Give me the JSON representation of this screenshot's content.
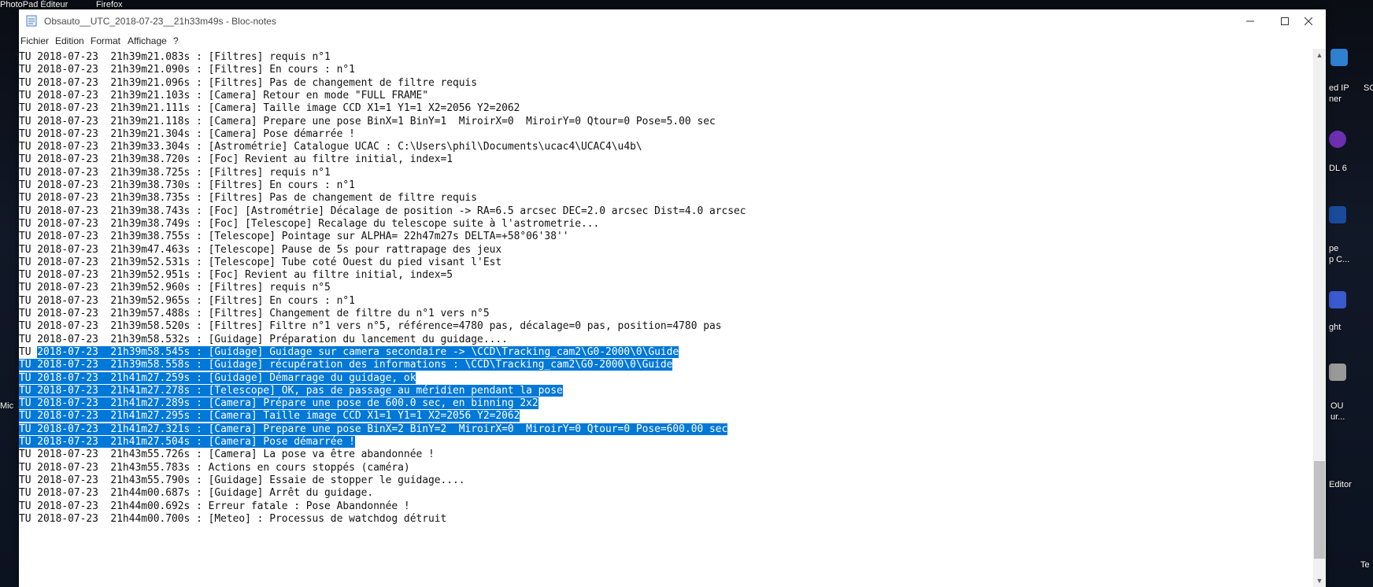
{
  "desktop": {
    "left_labels": [
      "PhotoPad Éditeur",
      "Firefox"
    ],
    "right_labels": [
      "ed IP",
      "ner",
      "DL 6",
      "pe",
      "p C...",
      "ght",
      "OU",
      "ur...",
      "Editor",
      "SC",
      "Te"
    ],
    "left_fragments": [
      "Mic"
    ]
  },
  "window": {
    "title": "Obsauto__UTC_2018-07-23__21h33m49s - Bloc-notes",
    "menu": [
      "Fichier",
      "Edition",
      "Format",
      "Affichage",
      "?"
    ]
  },
  "lines": [
    {
      "text": "TU 2018-07-23  21h39m21.083s : [Filtres] requis n°1",
      "selected": false
    },
    {
      "text": "TU 2018-07-23  21h39m21.090s : [Filtres] En cours : n°1",
      "selected": false
    },
    {
      "text": "TU 2018-07-23  21h39m21.096s : [Filtres] Pas de changement de filtre requis",
      "selected": false
    },
    {
      "text": "TU 2018-07-23  21h39m21.103s : [Camera] Retour en mode \"FULL FRAME\"",
      "selected": false
    },
    {
      "text": "TU 2018-07-23  21h39m21.111s : [Camera] Taille image CCD X1=1 Y1=1 X2=2056 Y2=2062",
      "selected": false
    },
    {
      "text": "TU 2018-07-23  21h39m21.118s : [Camera] Prepare une pose BinX=1 BinY=1  MiroirX=0  MiroirY=0 Qtour=0 Pose=5.00 sec",
      "selected": false
    },
    {
      "text": "TU 2018-07-23  21h39m21.304s : [Camera] Pose démarrée !",
      "selected": false
    },
    {
      "text": "TU 2018-07-23  21h39m33.304s : [Astrométrie] Catalogue UCAC : C:\\Users\\phil\\Documents\\ucac4\\UCAC4\\u4b\\",
      "selected": false
    },
    {
      "text": "TU 2018-07-23  21h39m38.720s : [Foc] Revient au filtre initial, index=1",
      "selected": false
    },
    {
      "text": "TU 2018-07-23  21h39m38.725s : [Filtres] requis n°1",
      "selected": false
    },
    {
      "text": "TU 2018-07-23  21h39m38.730s : [Filtres] En cours : n°1",
      "selected": false
    },
    {
      "text": "TU 2018-07-23  21h39m38.735s : [Filtres] Pas de changement de filtre requis",
      "selected": false
    },
    {
      "text": "TU 2018-07-23  21h39m38.743s : [Foc] [Astrométrie] Décalage de position -> RA=6.5 arcsec DEC=2.0 arcsec Dist=4.0 arcsec",
      "selected": false
    },
    {
      "text": "TU 2018-07-23  21h39m38.749s : [Foc] [Telescope] Recalage du telescope suite à l'astrometrie...",
      "selected": false
    },
    {
      "text": "TU 2018-07-23  21h39m38.755s : [Telescope] Pointage sur ALPHA= 22h47m27s DELTA=+58°06'38''",
      "selected": false
    },
    {
      "text": "TU 2018-07-23  21h39m47.463s : [Telescope] Pause de 5s pour rattrapage des jeux",
      "selected": false
    },
    {
      "text": "TU 2018-07-23  21h39m52.531s : [Telescope] Tube coté Ouest du pied visant l'Est",
      "selected": false
    },
    {
      "text": "TU 2018-07-23  21h39m52.951s : [Foc] Revient au filtre initial, index=5",
      "selected": false
    },
    {
      "text": "TU 2018-07-23  21h39m52.960s : [Filtres] requis n°5",
      "selected": false
    },
    {
      "text": "TU 2018-07-23  21h39m52.965s : [Filtres] En cours : n°1",
      "selected": false
    },
    {
      "text": "TU 2018-07-23  21h39m57.488s : [Filtres] Changement de filtre du n°1 vers n°5",
      "selected": false
    },
    {
      "text": "TU 2018-07-23  21h39m58.520s : [Filtres] Filtre n°1 vers n°5, référence=4780 pas, décalage=0 pas, position=4780 pas",
      "selected": false
    },
    {
      "text": "TU 2018-07-23  21h39m58.532s : [Guidage] Préparation du lancement du guidage....",
      "selected": false
    },
    {
      "prefix": "TU ",
      "text": "2018-07-23  21h39m58.545s : [Guidage] Guidage sur camera secondaire -> \\CCD\\Tracking_cam2\\G0-2000\\0\\Guide",
      "selected": true
    },
    {
      "prefix": "",
      "text": "TU 2018-07-23  21h39m58.558s : [Guidage] récupération des informations : \\CCD\\Tracking_cam2\\G0-2000\\0\\Guide",
      "selected": true
    },
    {
      "prefix": "",
      "text": "TU 2018-07-23  21h41m27.259s : [Guidage] Démarrage du guidage, ok",
      "selected": true
    },
    {
      "prefix": "",
      "text": "TU 2018-07-23  21h41m27.278s : [Telescope] OK, pas de passage au méridien pendant la pose",
      "selected": true
    },
    {
      "prefix": "",
      "text": "TU 2018-07-23  21h41m27.289s : [Camera] Prépare une pose de 600.0 sec, en binning 2x2",
      "selected": true
    },
    {
      "prefix": "",
      "text": "TU 2018-07-23  21h41m27.295s : [Camera] Taille image CCD X1=1 Y1=1 X2=2056 Y2=2062",
      "selected": true
    },
    {
      "prefix": "",
      "text": "TU 2018-07-23  21h41m27.321s : [Camera] Prepare une pose BinX=2 BinY=2  MiroirX=0  MiroirY=0 Qtour=0 Pose=600.00 sec",
      "selected": true
    },
    {
      "prefix": "",
      "text": "TU 2018-07-23  21h41m27.504s : [Camera] Pose démarrée !",
      "selected": true
    },
    {
      "text": "TU 2018-07-23  21h43m55.726s : [Camera] La pose va être abandonnée !",
      "selected": false
    },
    {
      "text": "TU 2018-07-23  21h43m55.783s : Actions en cours stoppés (caméra)",
      "selected": false
    },
    {
      "text": "TU 2018-07-23  21h43m55.790s : [Guidage] Essaie de stopper le guidage....",
      "selected": false
    },
    {
      "text": "TU 2018-07-23  21h44m00.687s : [Guidage] Arrêt du guidage.",
      "selected": false
    },
    {
      "text": "TU 2018-07-23  21h44m00.692s : Erreur fatale : Pose Abandonnée !",
      "selected": false
    },
    {
      "text": "TU 2018-07-23  21h44m00.700s : [Meteo] : Processus de watchdog détruit",
      "selected": false
    }
  ],
  "colors": {
    "selection": "#0078d7",
    "selection_text": "#ffffff",
    "text": "#111111"
  }
}
